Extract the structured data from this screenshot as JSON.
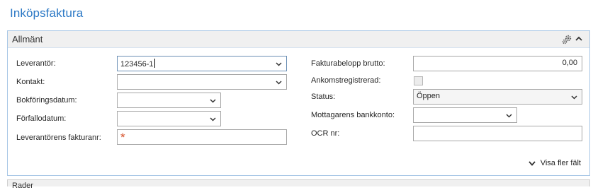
{
  "page": {
    "title": "Inköpsfaktura"
  },
  "section": {
    "title": "Allmänt",
    "show_more": "Visa fler fält"
  },
  "left": {
    "vendor": {
      "label": "Leverantör:",
      "value": "123456-1"
    },
    "contact": {
      "label": "Kontakt:",
      "value": ""
    },
    "posting_date": {
      "label": "Bokföringsdatum:",
      "value": ""
    },
    "due_date": {
      "label": "Förfallodatum:",
      "value": ""
    },
    "vendor_invoice_no": {
      "label": "Leverantörens fakturanr:",
      "value": "",
      "required_marker": "*"
    }
  },
  "right": {
    "invoice_amount": {
      "label": "Fakturabelopp brutto:",
      "value": "0,00"
    },
    "receipt_registered": {
      "label": "Ankomstregistrerad:",
      "checked": false
    },
    "status": {
      "label": "Status:",
      "value": "Öppen"
    },
    "bank_account": {
      "label": "Mottagarens bankkonto:",
      "value": ""
    },
    "ocr": {
      "label": "OCR nr:",
      "value": ""
    }
  },
  "next_section": {
    "title": "Rader"
  },
  "icons": [
    "gear-icon",
    "chevron-up-icon",
    "chevron-down-icon"
  ],
  "colors": {
    "title": "#2b78c5",
    "panel_border": "#a9c7e6",
    "required": "#d6512a"
  }
}
